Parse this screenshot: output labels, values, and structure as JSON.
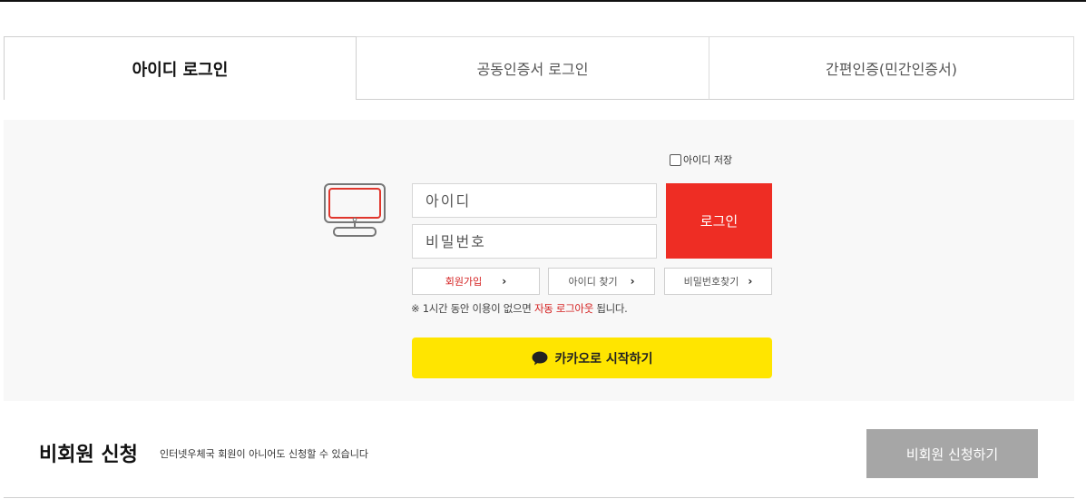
{
  "tabs": [
    {
      "label": "아이디 로그인",
      "active": true
    },
    {
      "label": "공동인증서 로그인",
      "active": false
    },
    {
      "label": "간편인증(민간인증서)",
      "active": false
    }
  ],
  "login": {
    "save_id_label": "아이디 저장",
    "id_placeholder": "아이디",
    "pw_placeholder": "비밀번호",
    "login_button": "로그인",
    "join_label": "회원가입",
    "find_id_label": "아이디 찾기",
    "find_pw_label": "비밀번호찾기",
    "arrow": "›",
    "notice_prefix": "※ 1시간 동안 이용이 없으면 ",
    "notice_highlight": "자동 로그아웃",
    "notice_suffix": " 됩니다.",
    "kakao_label": "카카오로 시작하기"
  },
  "guest": {
    "title": "비회원 신청",
    "description": "인터넷우체국 회원이 아니어도 신청할 수 있습니다",
    "button": "비회원 신청하기"
  },
  "colors": {
    "accent_red": "#ee2d24",
    "kakao_yellow": "#ffe500",
    "panel_bg": "#f8f8f8",
    "guest_button": "#a6a6a6"
  },
  "icons": {
    "monitor": "monitor-icon",
    "kakao": "speech-bubble-icon",
    "chevron": "chevron-right-icon"
  }
}
